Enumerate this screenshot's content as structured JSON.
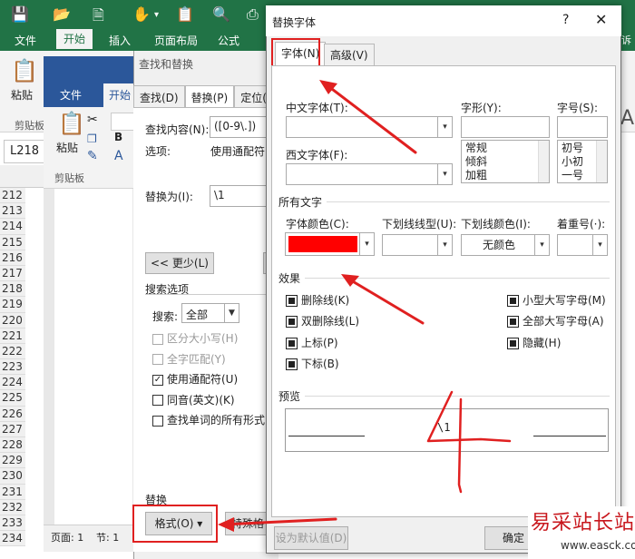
{
  "excel": {
    "ribbon_tabs": [
      "文件",
      "开始",
      "插入",
      "页面布局",
      "公式"
    ],
    "active_tab": "开始",
    "overflow_tab": "诉",
    "paste_label": "粘贴",
    "clipboard_label": "剪贴板",
    "name_box": "L218",
    "row_numbers": [
      "212",
      "213",
      "214",
      "215",
      "216",
      "217",
      "218",
      "219",
      "220",
      "221",
      "222",
      "223",
      "224",
      "225",
      "226",
      "227",
      "228",
      "229",
      "230",
      "231",
      "232",
      "233",
      "234"
    ]
  },
  "word": {
    "tabs": [
      "文件",
      "开始"
    ],
    "active_tab": "开始",
    "paste_label": "粘贴",
    "clipboard_label": "剪贴板",
    "status_page": "页面: 1",
    "status_section": "节: 1"
  },
  "find_replace": {
    "title": "查找和替换",
    "tabs": [
      "查找(D)",
      "替换(P)",
      "定位("
    ],
    "active_tab": "替换(P)",
    "find_label": "查找内容(N):",
    "find_value": "([0-9\\.])",
    "options_label": "选项:",
    "options_value": "使用通配符",
    "replace_label": "替换为(I):",
    "replace_value": "\\1",
    "less_button": "<< 更少(L)",
    "search_options_title": "搜索选项",
    "search_label": "搜索:",
    "search_value": "全部",
    "checkboxes": [
      {
        "label": "区分大小写(H)",
        "checked": false,
        "disabled": true
      },
      {
        "label": "全字匹配(Y)",
        "checked": false,
        "disabled": true
      },
      {
        "label": "使用通配符(U)",
        "checked": true,
        "disabled": false
      },
      {
        "label": "同音(英文)(K)",
        "checked": false,
        "disabled": false
      },
      {
        "label": "查找单词的所有形式(",
        "checked": false,
        "disabled": false
      }
    ],
    "replace_section": "替换",
    "format_button": "格式(O) ▾",
    "special_button": "特殊格"
  },
  "font_dialog": {
    "title": "替换字体",
    "help": "?",
    "close": "✕",
    "tabs": [
      "字体(N)",
      "高级(V)"
    ],
    "active_tab": "字体(N)",
    "chinese_font_label": "中文字体(T):",
    "western_font_label": "西文字体(F):",
    "style_label": "字形(Y):",
    "style_options": [
      "常规",
      "倾斜",
      "加粗"
    ],
    "size_label": "字号(S):",
    "size_options": [
      "初号",
      "小初",
      "一号"
    ],
    "all_text_title": "所有文字",
    "font_color_label": "字体颜色(C):",
    "font_color": "#ff0000",
    "underline_style_label": "下划线线型(U):",
    "underline_color_label": "下划线颜色(I):",
    "underline_color_value": "无颜色",
    "emphasis_label": "着重号(·):",
    "effects_title": "效果",
    "effects_left": [
      "删除线(K)",
      "双删除线(L)",
      "上标(P)",
      "下标(B)"
    ],
    "effects_right": [
      "小型大写字母(M)",
      "全部大写字母(A)",
      "隐藏(H)"
    ],
    "preview_title": "预览",
    "preview_text": "\\1",
    "default_button": "设为默认值(D)",
    "ok_button": "确定"
  },
  "watermark": {
    "name": "易采站长站",
    "url": "www.easck.com"
  },
  "colors": {
    "excel_green": "#217346",
    "word_blue": "#2b579a",
    "annotation_red": "#e02020"
  }
}
